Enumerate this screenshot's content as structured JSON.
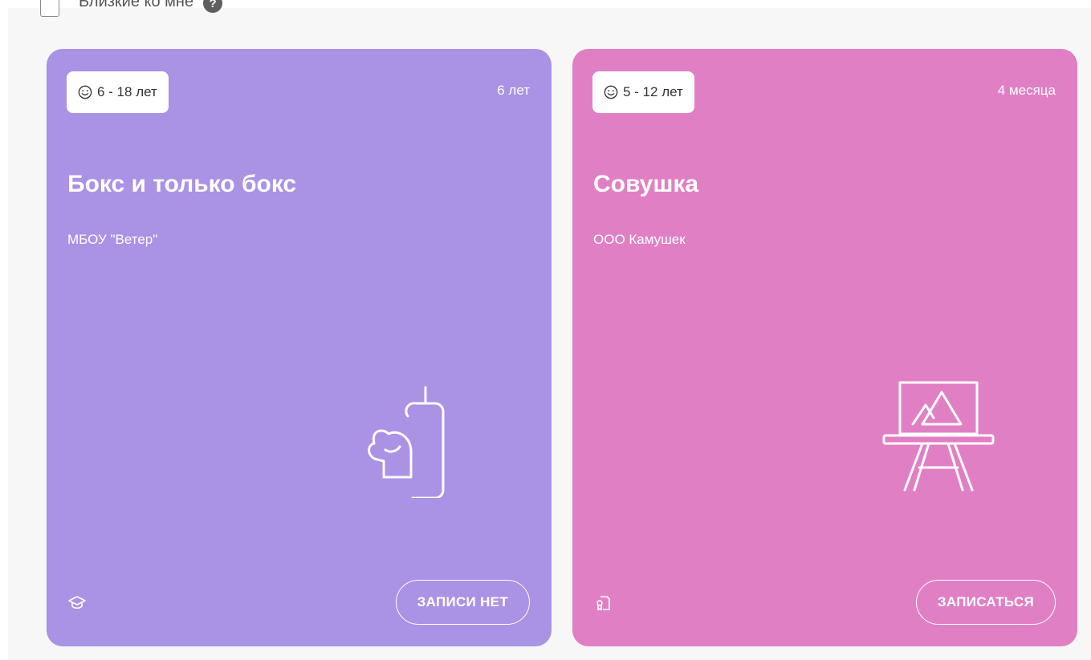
{
  "filter": {
    "label": "Близкие ко мне",
    "checked": false,
    "help_icon": "question-icon"
  },
  "cards": [
    {
      "age": "6 - 18 лет",
      "duration": "6 лет",
      "title": "Бокс и только бокс",
      "org": "МБОУ \"Ветер\"",
      "button": "ЗАПИСИ НЕТ",
      "color": "#aa92e5",
      "illustration_icon": "boxing-glove-punching-bag-icon",
      "footer_icon": "graduation-cap-icon"
    },
    {
      "age": "5 - 12 лет",
      "duration": "4 месяца",
      "title": "Совушка",
      "org": "ООО Камушек",
      "button": "ЗАПИСАТЬСЯ",
      "color": "#e17fc5",
      "illustration_icon": "easel-picture-icon",
      "footer_icon": "certificate-document-icon"
    }
  ]
}
